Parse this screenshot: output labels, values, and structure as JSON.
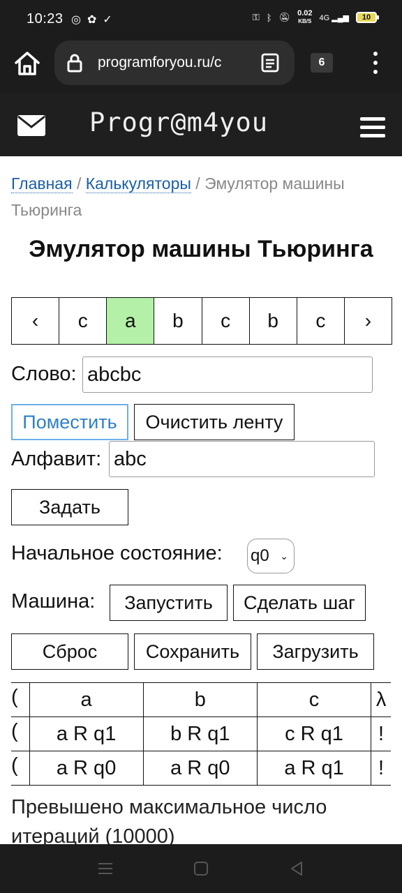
{
  "status_bar": {
    "time": "10:23",
    "net_speed_value": "0.02",
    "net_speed_unit": "KB/S",
    "network": "4G",
    "battery": "10"
  },
  "browser": {
    "url": "programforyou.ru/c",
    "tab_count": "6"
  },
  "site": {
    "logo": "Progr@m4you"
  },
  "breadcrumb": {
    "home": "Главная",
    "sep1": "/",
    "calculators": "Калькуляторы",
    "sep2": "/",
    "current": "Эмулятор машины Тьюринга"
  },
  "page_title": "Эмулятор машины Тьюринга",
  "tape": {
    "left_arrow": "‹",
    "right_arrow": "›",
    "cells": [
      "c",
      "a",
      "b",
      "c",
      "b",
      "c"
    ],
    "active_index": 1,
    "active_color": "#b5f0a8"
  },
  "word": {
    "label": "Слово:",
    "value": "abcbc"
  },
  "buttons": {
    "place": "Поместить",
    "clear_tape": "Очистить ленту",
    "set": "Задать",
    "run": "Запустить",
    "step": "Сделать шаг",
    "reset": "Сброс",
    "save": "Сохранить",
    "load": "Загрузить"
  },
  "alphabet": {
    "label": "Алфавит:",
    "value": "abc"
  },
  "initial_state": {
    "label": "Начальное состояние:",
    "selected": "q0"
  },
  "machine_label": "Машина:",
  "rules_table": {
    "header_first": ")",
    "headers": [
      "a",
      "b",
      "c",
      "λ"
    ],
    "rows": [
      {
        "state": ")",
        "cells": [
          "a R q1",
          "b R q1",
          "c R q1",
          "!"
        ]
      },
      {
        "state": ")",
        "cells": [
          "a R q0",
          "a R q0",
          "a R q1",
          "!"
        ]
      }
    ]
  },
  "error_message": "Превышено максимальное число итераций (10000)"
}
